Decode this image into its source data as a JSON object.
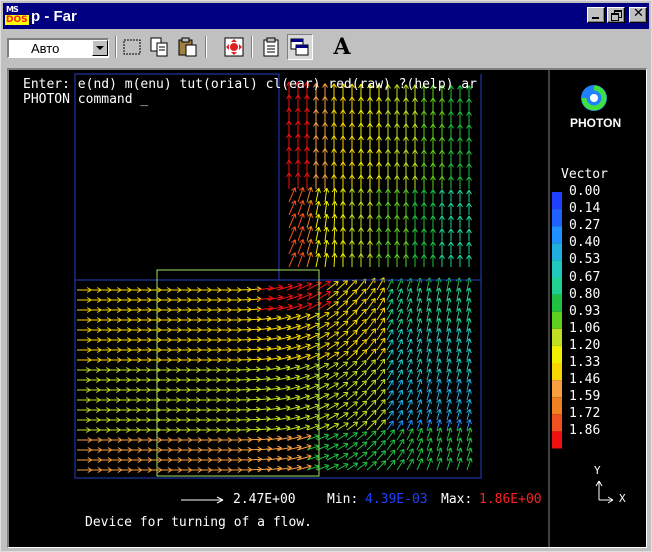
{
  "window": {
    "title": "p - Far",
    "icon_top": "MS",
    "icon_bottom": "DOS"
  },
  "toolbar": {
    "font_select": "Авто",
    "tools": [
      "mark-icon",
      "copy-icon",
      "paste-icon",
      "fullscreen-icon",
      "properties-icon",
      "background-icon",
      "font-icon"
    ],
    "font_button_label": "A"
  },
  "console": {
    "prompt_line": "Enter: e(nd) m(enu) tut(orial) cl(ear) red(raw) ?(help) ar",
    "command_line": "PHOTON command _",
    "caption": "Device for turning of a flow.",
    "scale_value": "2.47E+00",
    "min_label": "Min:",
    "min_value": "4.39E-03",
    "max_label": "Max:",
    "max_value": "1.86E+00"
  },
  "legend": {
    "logo_text": "PHOTON",
    "title": "Vector",
    "entries": [
      {
        "label": "0.00",
        "color": "#2040ff"
      },
      {
        "label": "0.14",
        "color": "#2060ff"
      },
      {
        "label": "0.27",
        "color": "#2090ff"
      },
      {
        "label": "0.40",
        "color": "#20b0e0"
      },
      {
        "label": "0.53",
        "color": "#20c8c0"
      },
      {
        "label": "0.67",
        "color": "#20d090"
      },
      {
        "label": "0.80",
        "color": "#20c040"
      },
      {
        "label": "0.93",
        "color": "#60d020"
      },
      {
        "label": "1.06",
        "color": "#c0e020"
      },
      {
        "label": "1.20",
        "color": "#f0f000"
      },
      {
        "label": "1.33",
        "color": "#f8d800"
      },
      {
        "label": "1.46",
        "color": "#f8a040"
      },
      {
        "label": "1.59",
        "color": "#f08020"
      },
      {
        "label": "1.72",
        "color": "#f05020"
      },
      {
        "label": "1.86",
        "color": "#f01010"
      }
    ],
    "axis_y": "Y",
    "axis_x": "X"
  },
  "colors": {
    "min_color": "#2040ff",
    "max_color": "#ff2020",
    "box_outline": "#2040c0",
    "region_outline": "#a0e060"
  }
}
